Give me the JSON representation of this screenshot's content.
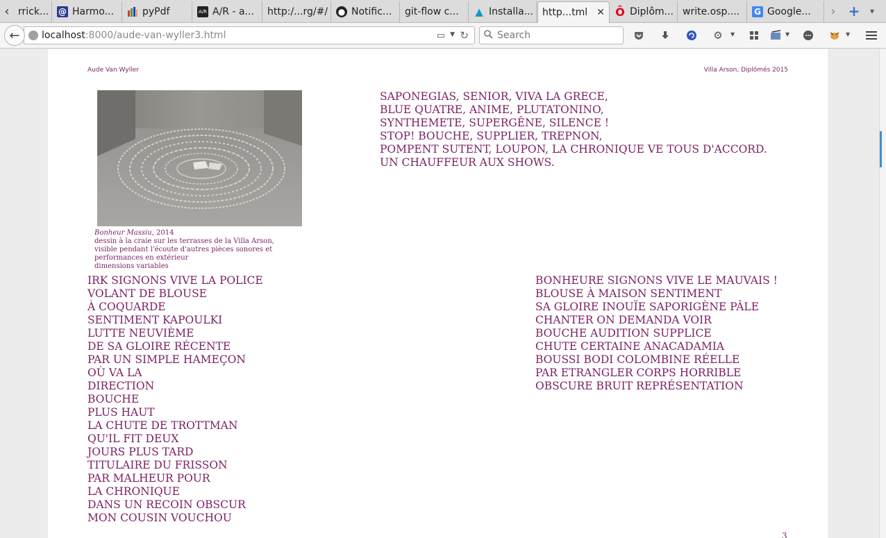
{
  "tabs": [
    {
      "label": "rrick...",
      "icon": "partial-tab-icon",
      "active": false
    },
    {
      "label": "Harmo...",
      "icon": "at-sign-icon",
      "active": false
    },
    {
      "label": "pyPdf",
      "icon": "pypdf-icon",
      "active": false
    },
    {
      "label": "A/R - a...",
      "icon": "ar-icon",
      "active": false
    },
    {
      "label": "http:/...rg/#/",
      "icon": "",
      "active": false
    },
    {
      "label": "Notific...",
      "icon": "github-icon",
      "active": false
    },
    {
      "label": "git-flow c...",
      "icon": "",
      "active": false
    },
    {
      "label": "Installa...",
      "icon": "arch-icon",
      "active": false
    },
    {
      "label": "http...tml",
      "icon": "",
      "active": true
    },
    {
      "label": "Diplôm...",
      "icon": "opera-icon",
      "active": false
    },
    {
      "label": "write.osp....",
      "icon": "",
      "active": false
    },
    {
      "label": "Google...",
      "icon": "google-icon",
      "active": false
    }
  ],
  "nav": {
    "url_host": "localhost",
    "url_rest": ":8000/aude-van-wyller3.html",
    "search_placeholder": "Search"
  },
  "page": {
    "header_left": "Aude Van Wyller",
    "header_right": "Villa Arson, Diplômés 2015",
    "caption": {
      "title": "Bonheur Massiu",
      "year": ", 2014",
      "lines": [
        "dessin à la craie sur les terrasses de la Villa Arson,",
        "visible pendant l'écoute d'autres pièces sonores et",
        "performances en extérieur",
        "dimensions variables"
      ]
    },
    "top_verse": [
      "SAPONEGIAS, SENIOR, VIVA LA GRECE,",
      "BLUE QUATRE, ANIME, PLUTATONINO,",
      "SYNTHEMETE, SUPERGÊNE, SILENCE !",
      "STOP! BOUCHE, SUPPLIER, TREPNON,",
      "POMPENT SUTENT, LOUPON, LA CHRONIQUE VE TOUS D'ACCORD.",
      "UN CHAUFFEUR AUX SHOWS."
    ],
    "left_verse": [
      "IRK SIGNONS VIVE LA POLICE",
      "VOLANT DE BLOUSE",
      "À COQUARDE",
      "SENTIMENT KAPOULKI",
      "LUTTE NEUVIÈME",
      "DE SA GLOIRE RÉCENTE",
      "PAR UN SIMPLE HAMEÇON",
      "OÙ VA LA",
      "DIRECTION",
      "BOUCHE",
      "PLUS HAUT",
      "LA CHUTE DE TROTTMAN",
      "QU'IL FIT DEUX",
      "JOURS PLUS TARD",
      "TITULAIRE DU FRISSON",
      "PAR MALHEUR POUR",
      "LA CHRONIQUE",
      "DANS UN RECOIN OBSCUR",
      "MON COUSIN VOUCHOU"
    ],
    "right_verse": [
      "BONHEURE SIGNONS VIVE LE MAUVAIS !",
      "BLOUSE À MAISON SENTIMENT",
      "SA GLOIRE INOUÏE SAPORIGÈNE PÂLE",
      "CHANTER ON DEMANDA VOIR",
      "BOUCHE AUDITION SUPPLICE",
      "CHUTE CERTAINE ANACADAMIA",
      "BOUSSI BODI COLOMBINE RÉELLE",
      "PAR ETRANGLER CORPS HORRIBLE",
      "OBSCURE BRUIT REPRÉSENTATION"
    ],
    "page_number": "3"
  },
  "colors": {
    "text_accent": "#7a1f63",
    "scroll_thumb": "#3b8fd5"
  }
}
